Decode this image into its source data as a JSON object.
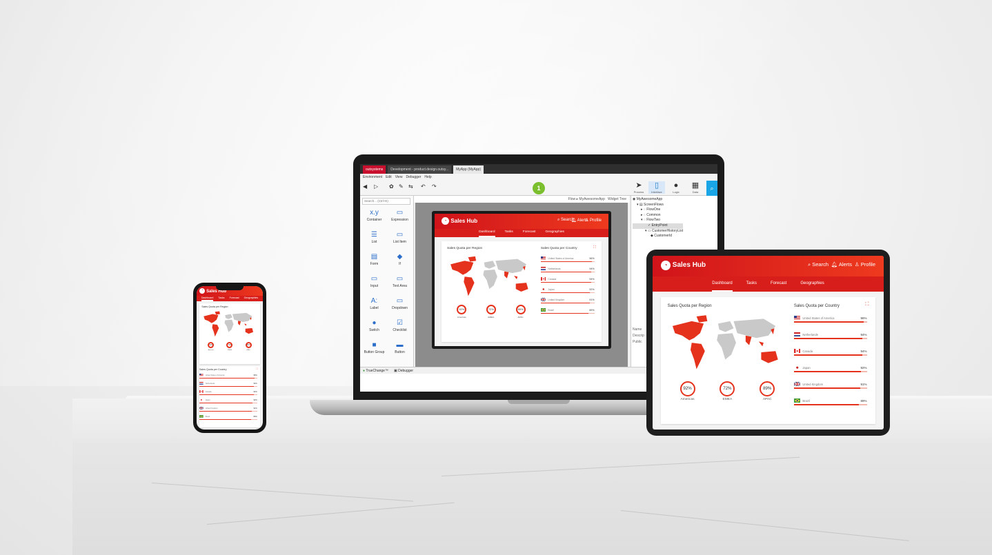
{
  "colors": {
    "brand_red": "#e5321d",
    "ide_green": "#7bbf2e",
    "ide_blue": "#1aa5e6"
  },
  "ide": {
    "tabs": [
      "outsystems",
      "Development - product.design.outsy...",
      "MyApp (MyApp)"
    ],
    "menu": [
      "Environment",
      "Edit",
      "View",
      "Debugger",
      "Help"
    ],
    "badge": "1",
    "tools": [
      {
        "label": "Process",
        "icon": "process-icon"
      },
      {
        "label": "Interface",
        "icon": "interface-icon"
      },
      {
        "label": "Logic",
        "icon": "logic-icon"
      },
      {
        "label": "Data",
        "icon": "data-icon"
      }
    ],
    "search_placeholder": "Search... (Ctrl+E)",
    "widgets": [
      "Container",
      "Expression",
      "List",
      "List Item",
      "Form",
      "If",
      "Input",
      "Text Area",
      "Label",
      "Dropdown",
      "Switch",
      "Checklist",
      "Button Group",
      "Button"
    ],
    "breadcrumb": "Flow ▸ MyAwesomeApp",
    "widget_tree": "Widget Tree",
    "tree": [
      "MyAwesomeApp",
      "ScreenFlows",
      "FlowOne",
      "Common",
      "FlowTwo",
      "EntryPoint",
      "CustomerHistoryList",
      "CustomerId"
    ],
    "props": [
      "Name",
      "Descrip",
      "Public"
    ],
    "status": [
      "TrueChange™",
      "Debugger"
    ]
  },
  "app": {
    "name": "Sales Hub",
    "actions": [
      "Search",
      "Alerts",
      "Profile"
    ],
    "nav": [
      "Dashboard",
      "Tasks",
      "Forecast",
      "Geographies"
    ],
    "region_title": "Sales Quota per Region",
    "country_title": "Sales Quota per Country",
    "regions": [
      {
        "pct": "92%",
        "name": "Americas",
        "value": 92
      },
      {
        "pct": "72%",
        "name": "EMEA",
        "value": 72
      },
      {
        "pct": "89%",
        "name": "APAC",
        "value": 89
      }
    ],
    "countries": [
      {
        "name": "United States of America",
        "pct": "96%",
        "value": 96,
        "flag": "us-flag-icon"
      },
      {
        "name": "Netherlands",
        "pct": "94%",
        "value": 94,
        "flag": "nl-flag-icon"
      },
      {
        "name": "Canada",
        "pct": "94%",
        "value": 94,
        "flag": "ca-flag-icon"
      },
      {
        "name": "Japan",
        "pct": "92%",
        "value": 92,
        "flag": "jp-flag-icon"
      },
      {
        "name": "United Kingdom",
        "pct": "91%",
        "value": 91,
        "flag": "uk-flag-icon"
      },
      {
        "name": "Brazil",
        "pct": "89%",
        "value": 89,
        "flag": "br-flag-icon"
      }
    ]
  }
}
